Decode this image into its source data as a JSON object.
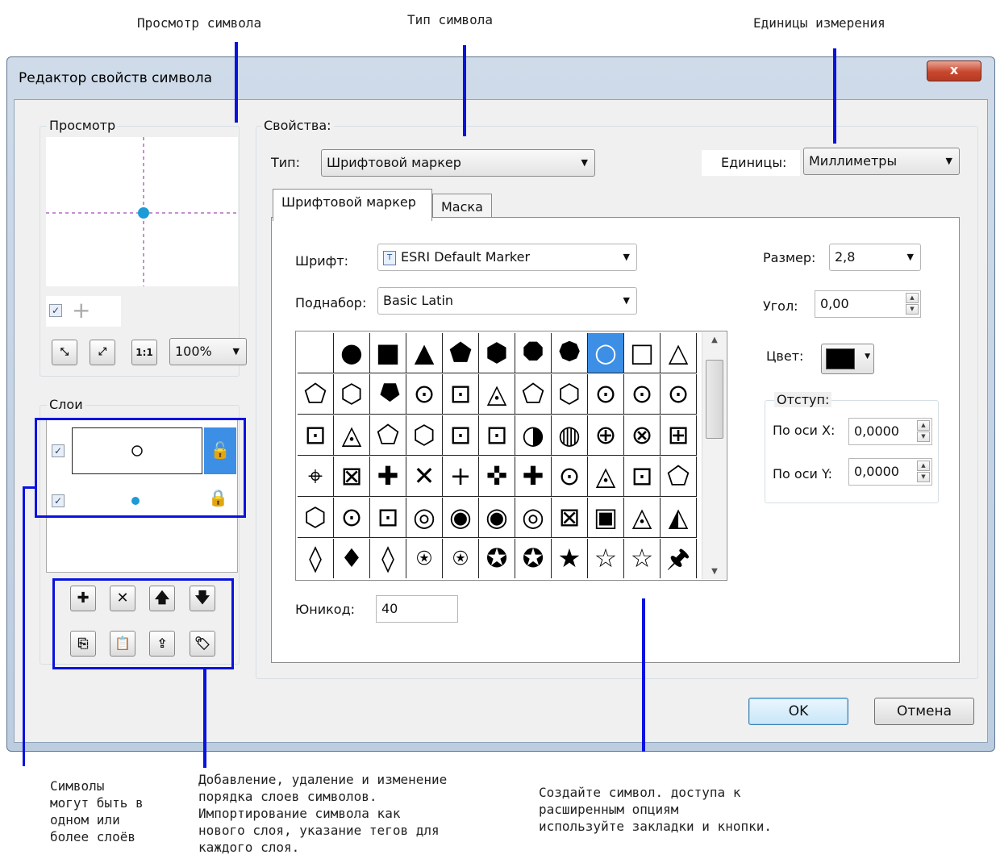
{
  "callouts": {
    "preview": "Просмотр символа",
    "type": "Тип символа",
    "units": "Единицы измерения",
    "layers": "Символы\nмогут быть в\nодном или\nболее слоёв",
    "tools": "Добавление, удаление и изменение\nпорядка слоев символов.\nИмпортирование символа как\nнового слоя, указание тегов для\nкаждого слоя.",
    "create": "Создайте символ. доступа к\nрасширенным опциям\nиспользуйте закладки и кнопки."
  },
  "window": {
    "title": "Редактор свойств символа",
    "close": "x"
  },
  "preview_group": {
    "label": "Просмотр",
    "zoom": "100%",
    "zoom_options": [
      "100%"
    ]
  },
  "layers_group": {
    "label": "Слои"
  },
  "properties": {
    "label": "Свойства:",
    "type_label": "Тип:",
    "type_value": "Шрифтовой маркер",
    "units_label": "Единицы:",
    "units_value": "Миллиметры"
  },
  "tabs": [
    {
      "label": "Шрифтовой маркер"
    },
    {
      "label": "Маска"
    }
  ],
  "font_marker": {
    "font_label": "Шрифт:",
    "font_value": "ESRI Default Marker",
    "subset_label": "Поднабор:",
    "subset_value": "Basic Latin",
    "unicode_label": "Юникод:",
    "unicode_value": "40",
    "size_label": "Размер:",
    "size_value": "2,8",
    "angle_label": "Угол:",
    "angle_value": "0,00",
    "color_label": "Цвет:",
    "color_value": "#000000",
    "offset_label": "Отступ:",
    "offset_x_label": "По оси X:",
    "offset_x_value": "0,0000",
    "offset_y_label": "По оси Y:",
    "offset_y_value": "0,0000"
  },
  "glyphs": [
    [
      "",
      "●",
      "■",
      "▲",
      "⬟",
      "⬢",
      "⯃",
      "⯄",
      "○",
      "□",
      "△"
    ],
    [
      "⬠",
      "⬡",
      "⯂",
      "⊙",
      "⊡",
      "◬",
      "⬠",
      "⬡",
      "⊙",
      "⊙",
      "⊙"
    ],
    [
      "⊡",
      "◬",
      "⬠",
      "⬡",
      "⊡",
      "⊡",
      "◑",
      "◍",
      "⊕",
      "⊗",
      "⊞"
    ],
    [
      "⌖",
      "⊠",
      "✚",
      "✕",
      "+",
      "✜",
      "✚",
      "⊙",
      "◬",
      "⊡",
      "⬠"
    ],
    [
      "⬡",
      "⊙",
      "⊡",
      "◎",
      "◉",
      "◉",
      "◎",
      "⊠",
      "▣",
      "◬",
      "◭"
    ],
    [
      "◊",
      "♦",
      "◊",
      "⍟",
      "⍟",
      "✪",
      "✪",
      "★",
      "☆",
      "☆",
      "🖈"
    ]
  ],
  "buttons": {
    "ok": "OK",
    "cancel": "Отмена"
  },
  "colors": {
    "callout_blue": "#0a12e0",
    "selection_blue": "#3d8fe6",
    "preview_point": "#1e9ad6"
  }
}
